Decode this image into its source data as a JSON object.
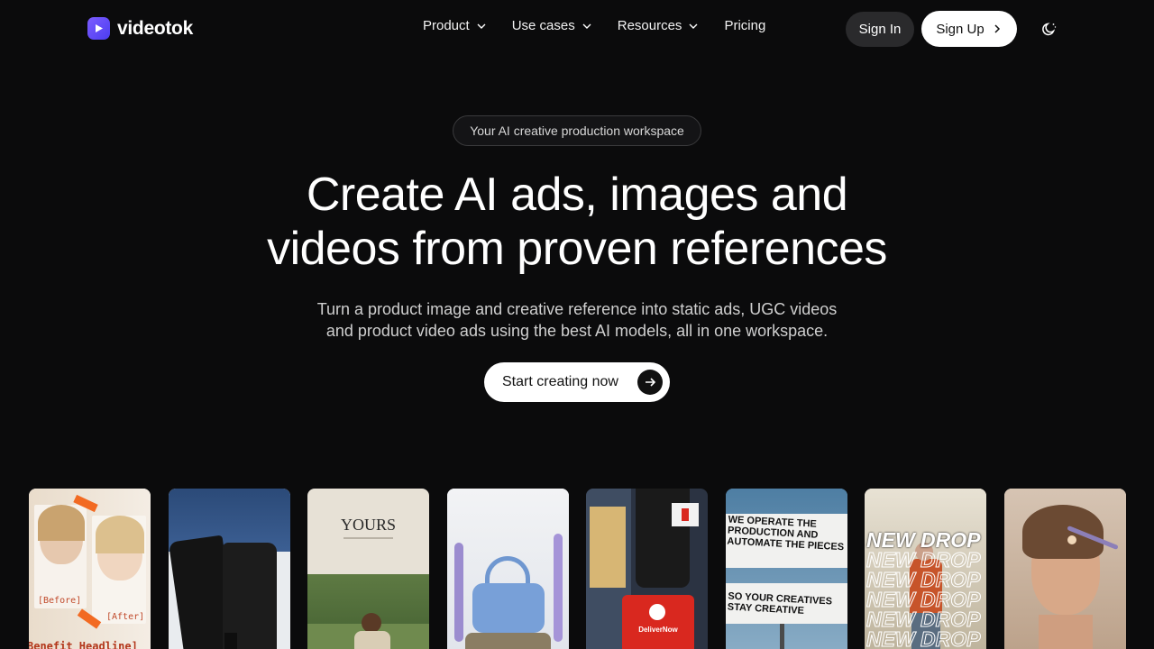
{
  "brand": {
    "name": "videotok",
    "accent": "#6b4cff"
  },
  "nav": {
    "items": [
      {
        "label": "Product",
        "has_dropdown": true
      },
      {
        "label": "Use cases",
        "has_dropdown": true
      },
      {
        "label": "Resources",
        "has_dropdown": true
      },
      {
        "label": "Pricing",
        "has_dropdown": false
      }
    ],
    "sign_in": "Sign In",
    "sign_up": "Sign Up",
    "theme_icon": "moon-icon"
  },
  "hero": {
    "badge": "Your AI creative production workspace",
    "headline_line1": "Create AI ads, images and",
    "headline_line2": "videos from proven references",
    "sub_line1": "Turn a product image and creative reference into static ads, UGC videos",
    "sub_line2": "and product video ads using the best AI models, all in one workspace.",
    "cta": "Start creating now"
  },
  "gallery": {
    "card1": {
      "before": "[Before]",
      "after": "[After]",
      "headline": "Benefit Headline]"
    },
    "card3": {
      "title": "YOURS"
    },
    "card5": {
      "brand": "DeliverNow"
    },
    "card6": {
      "top_text": "WE    OPERATE THE PRODUCTION AND AUTOMATE THE PIECES",
      "bottom_text": "SO YOUR CREATIVES STAY CREATIVE"
    },
    "card7": {
      "repeat_text": "NEW DROP"
    }
  }
}
